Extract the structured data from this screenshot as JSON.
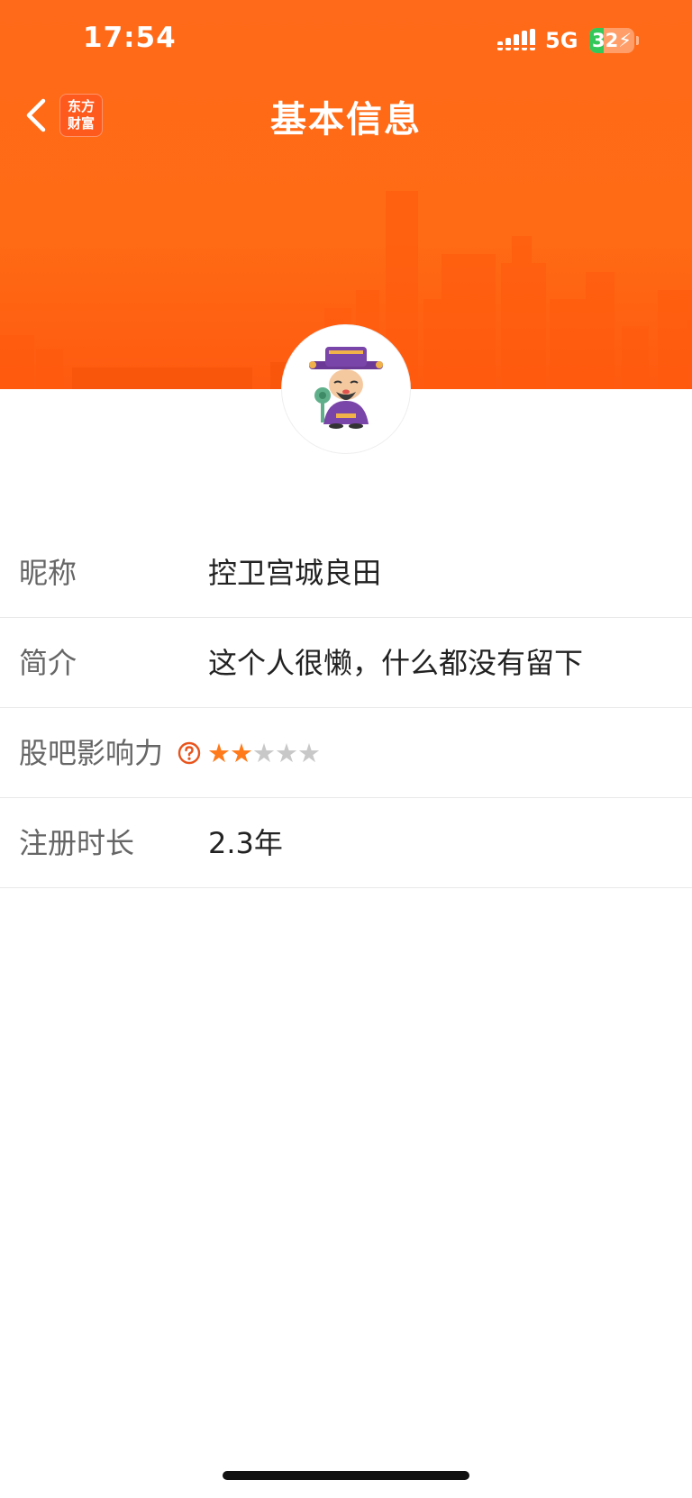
{
  "status_bar": {
    "time": "17:54",
    "network": "5G",
    "battery_level": "32",
    "battery_charging": true
  },
  "nav": {
    "title": "基本信息",
    "logo_line1": "东方",
    "logo_line2": "财富",
    "back_icon": "chevron-left-icon"
  },
  "colors": {
    "header_orange": "#ff6a1a",
    "star_active": "#ff7a1a",
    "star_inactive": "#c8c8c8",
    "help_icon": "#e8541c"
  },
  "profile": {
    "fields": [
      {
        "label": "昵称",
        "value": "控卫宫城良田"
      },
      {
        "label": "简介",
        "value": "这个人很懒，什么都没有留下"
      },
      {
        "label": "股吧影响力",
        "rating": 2,
        "rating_max": 5,
        "help_icon": "question-circle-icon"
      },
      {
        "label": "注册时长",
        "value": "2.3年"
      }
    ]
  }
}
